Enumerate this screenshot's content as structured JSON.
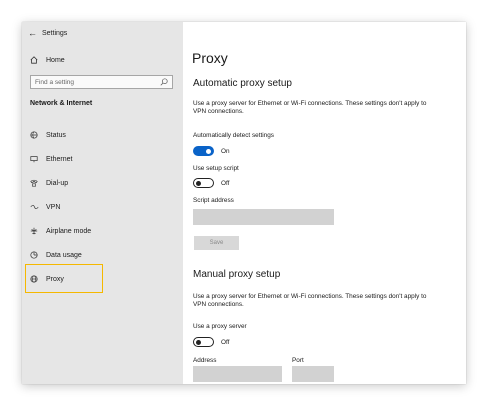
{
  "window": {
    "title": "Settings",
    "back_icon": "back-arrow-icon"
  },
  "sidebar": {
    "home": {
      "label": "Home",
      "icon": "home-icon"
    },
    "search": {
      "placeholder": "Find a setting",
      "icon": "search-icon"
    },
    "section": "Network & Internet",
    "items": [
      {
        "label": "Status",
        "icon": "globe-status-icon"
      },
      {
        "label": "Ethernet",
        "icon": "ethernet-icon"
      },
      {
        "label": "Dial-up",
        "icon": "dialup-icon"
      },
      {
        "label": "VPN",
        "icon": "vpn-icon"
      },
      {
        "label": "Airplane mode",
        "icon": "airplane-icon"
      },
      {
        "label": "Data usage",
        "icon": "data-usage-icon"
      },
      {
        "label": "Proxy",
        "icon": "globe-icon",
        "selected": true
      }
    ],
    "highlight_color": "#f5b800"
  },
  "main": {
    "title": "Proxy",
    "automatic": {
      "heading": "Automatic proxy setup",
      "description": "Use a proxy server for Ethernet or Wi-Fi connections. These settings don't apply to VPN connections.",
      "auto_detect": {
        "label": "Automatically detect settings",
        "state": "On"
      },
      "setup_script": {
        "label": "Use setup script",
        "state": "Off"
      },
      "script_address": {
        "label": "Script address",
        "value": ""
      },
      "save_label": "Save"
    },
    "manual": {
      "heading": "Manual proxy setup",
      "description": "Use a proxy server for Ethernet or Wi-Fi connections. These settings don't apply to VPN connections.",
      "use_proxy": {
        "label": "Use a proxy server",
        "state": "Off"
      },
      "address": {
        "label": "Address",
        "value": ""
      },
      "port": {
        "label": "Port",
        "value": ""
      }
    },
    "accent_color": "#0a63c8"
  }
}
